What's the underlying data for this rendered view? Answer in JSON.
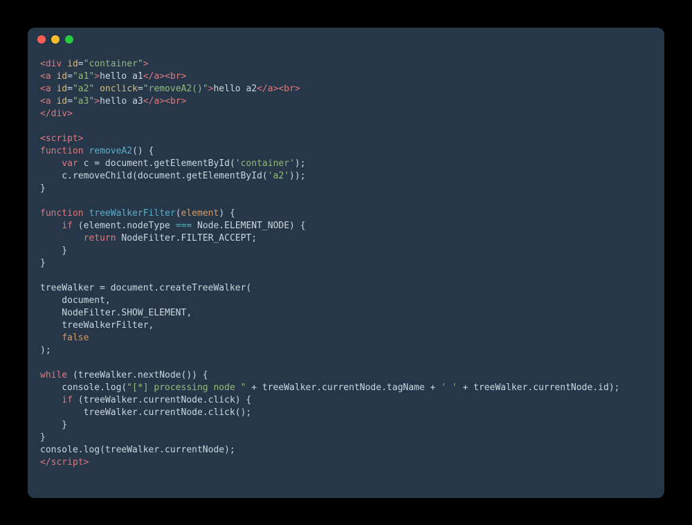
{
  "colors": {
    "background_page": "#000000",
    "background_window": "#263749",
    "traffic_red": "#ff5f56",
    "traffic_yellow": "#ffbd2e",
    "traffic_green": "#27c93f",
    "text_default": "#ccd7e0",
    "text_tag": "#e2787d",
    "text_attr": "#dcbb74",
    "text_string": "#93bb7a",
    "text_keyword": "#e2787d",
    "text_func": "#5ab0c7",
    "text_param": "#d59a66",
    "text_bool": "#d59a66",
    "text_eq": "#5ab0c7"
  },
  "code": {
    "language": "html",
    "tokens": [
      [
        [
          "tag",
          "<div"
        ],
        [
          "default",
          " "
        ],
        [
          "attr",
          "id"
        ],
        [
          "default",
          "="
        ],
        [
          "string",
          "\"container\""
        ],
        [
          "tag",
          ">"
        ]
      ],
      [
        [
          "tag",
          "<a"
        ],
        [
          "default",
          " "
        ],
        [
          "attr",
          "id"
        ],
        [
          "default",
          "="
        ],
        [
          "string",
          "\"a1\""
        ],
        [
          "tag",
          ">"
        ],
        [
          "default",
          "hello a1"
        ],
        [
          "tag",
          "</a><br>"
        ]
      ],
      [
        [
          "tag",
          "<a"
        ],
        [
          "default",
          " "
        ],
        [
          "attr",
          "id"
        ],
        [
          "default",
          "="
        ],
        [
          "string",
          "\"a2\""
        ],
        [
          "default",
          " "
        ],
        [
          "attr",
          "onclick"
        ],
        [
          "default",
          "="
        ],
        [
          "string",
          "\"removeA2()\""
        ],
        [
          "tag",
          ">"
        ],
        [
          "default",
          "hello a2"
        ],
        [
          "tag",
          "</a><br>"
        ]
      ],
      [
        [
          "tag",
          "<a"
        ],
        [
          "default",
          " "
        ],
        [
          "attr",
          "id"
        ],
        [
          "default",
          "="
        ],
        [
          "string",
          "\"a3\""
        ],
        [
          "tag",
          ">"
        ],
        [
          "default",
          "hello a3"
        ],
        [
          "tag",
          "</a><br>"
        ]
      ],
      [
        [
          "tag",
          "</div>"
        ]
      ],
      [
        [
          "default",
          ""
        ]
      ],
      [
        [
          "tag",
          "<script>"
        ]
      ],
      [
        [
          "keyword",
          "function"
        ],
        [
          "default",
          " "
        ],
        [
          "func",
          "removeA2"
        ],
        [
          "default",
          "() {"
        ]
      ],
      [
        [
          "default",
          "    "
        ],
        [
          "keyword",
          "var"
        ],
        [
          "default",
          " c = document.getElementById("
        ],
        [
          "string",
          "'container'"
        ],
        [
          "default",
          ");"
        ]
      ],
      [
        [
          "default",
          "    c.removeChild(document.getElementById("
        ],
        [
          "string",
          "'a2'"
        ],
        [
          "default",
          "));"
        ]
      ],
      [
        [
          "default",
          "}"
        ]
      ],
      [
        [
          "default",
          ""
        ]
      ],
      [
        [
          "keyword",
          "function"
        ],
        [
          "default",
          " "
        ],
        [
          "func",
          "treeWalkerFilter"
        ],
        [
          "default",
          "("
        ],
        [
          "param",
          "element"
        ],
        [
          "default",
          ") {"
        ]
      ],
      [
        [
          "default",
          "    "
        ],
        [
          "keyword",
          "if"
        ],
        [
          "default",
          " (element.nodeType "
        ],
        [
          "eq",
          "==="
        ],
        [
          "default",
          " Node.ELEMENT_NODE) {"
        ]
      ],
      [
        [
          "default",
          "        "
        ],
        [
          "keyword",
          "return"
        ],
        [
          "default",
          " NodeFilter.FILTER_ACCEPT;"
        ]
      ],
      [
        [
          "default",
          "    }"
        ]
      ],
      [
        [
          "default",
          "}"
        ]
      ],
      [
        [
          "default",
          ""
        ]
      ],
      [
        [
          "default",
          "treeWalker = document.createTreeWalker("
        ]
      ],
      [
        [
          "default",
          "    document,"
        ]
      ],
      [
        [
          "default",
          "    NodeFilter.SHOW_ELEMENT,"
        ]
      ],
      [
        [
          "default",
          "    treeWalkerFilter,"
        ]
      ],
      [
        [
          "default",
          "    "
        ],
        [
          "bool",
          "false"
        ]
      ],
      [
        [
          "default",
          ");"
        ]
      ],
      [
        [
          "default",
          ""
        ]
      ],
      [
        [
          "keyword",
          "while"
        ],
        [
          "default",
          " (treeWalker.nextNode()) {"
        ]
      ],
      [
        [
          "default",
          "    console.log("
        ],
        [
          "string",
          "\"[*] processing node \""
        ],
        [
          "default",
          " + treeWalker.currentNode.tagName + "
        ],
        [
          "string",
          "' '"
        ],
        [
          "default",
          " + treeWalker.currentNode.id);"
        ]
      ],
      [
        [
          "default",
          "    "
        ],
        [
          "keyword",
          "if"
        ],
        [
          "default",
          " (treeWalker.currentNode.click) {"
        ]
      ],
      [
        [
          "default",
          "        treeWalker.currentNode.click();"
        ]
      ],
      [
        [
          "default",
          "    }"
        ]
      ],
      [
        [
          "default",
          "}"
        ]
      ],
      [
        [
          "default",
          "console.log(treeWalker.currentNode);"
        ]
      ],
      [
        [
          "tag",
          "</script>"
        ]
      ]
    ]
  }
}
